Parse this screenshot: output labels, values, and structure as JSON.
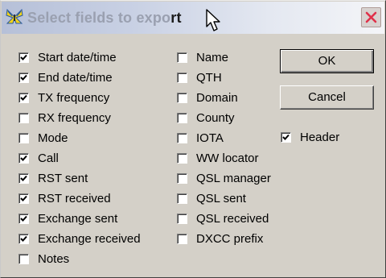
{
  "dialog": {
    "title_faded": "Select fields to expo",
    "title_dark": "rt"
  },
  "fields_col1": [
    {
      "label": "Start date/time",
      "checked": true
    },
    {
      "label": "End date/time",
      "checked": true
    },
    {
      "label": "TX frequency",
      "checked": true
    },
    {
      "label": "RX frequency",
      "checked": false
    },
    {
      "label": "Mode",
      "checked": false
    },
    {
      "label": "Call",
      "checked": true
    },
    {
      "label": "RST sent",
      "checked": true
    },
    {
      "label": "RST received",
      "checked": true
    },
    {
      "label": "Exchange sent",
      "checked": true
    },
    {
      "label": "Exchange received",
      "checked": true
    },
    {
      "label": "Notes",
      "checked": false
    }
  ],
  "fields_col2": [
    {
      "label": "Name",
      "checked": false
    },
    {
      "label": "QTH",
      "checked": false
    },
    {
      "label": "Domain",
      "checked": false
    },
    {
      "label": "County",
      "checked": false
    },
    {
      "label": "IOTA",
      "checked": false
    },
    {
      "label": "WW locator",
      "checked": false
    },
    {
      "label": "QSL manager",
      "checked": false
    },
    {
      "label": "QSL sent",
      "checked": false
    },
    {
      "label": "QSL received",
      "checked": false
    },
    {
      "label": "DXCC prefix",
      "checked": false
    }
  ],
  "buttons": {
    "ok_label": "OK",
    "cancel_label": "Cancel"
  },
  "header_option": {
    "label": "Header",
    "checked": true
  },
  "icons": {
    "app": "butterfly-icon",
    "close": "close-icon",
    "cursor": "mouse-pointer-icon"
  },
  "colors": {
    "dialog_face": "#d4d0c8",
    "title_text_faded": "#9aa0b0",
    "close_x": "#e0304a"
  }
}
